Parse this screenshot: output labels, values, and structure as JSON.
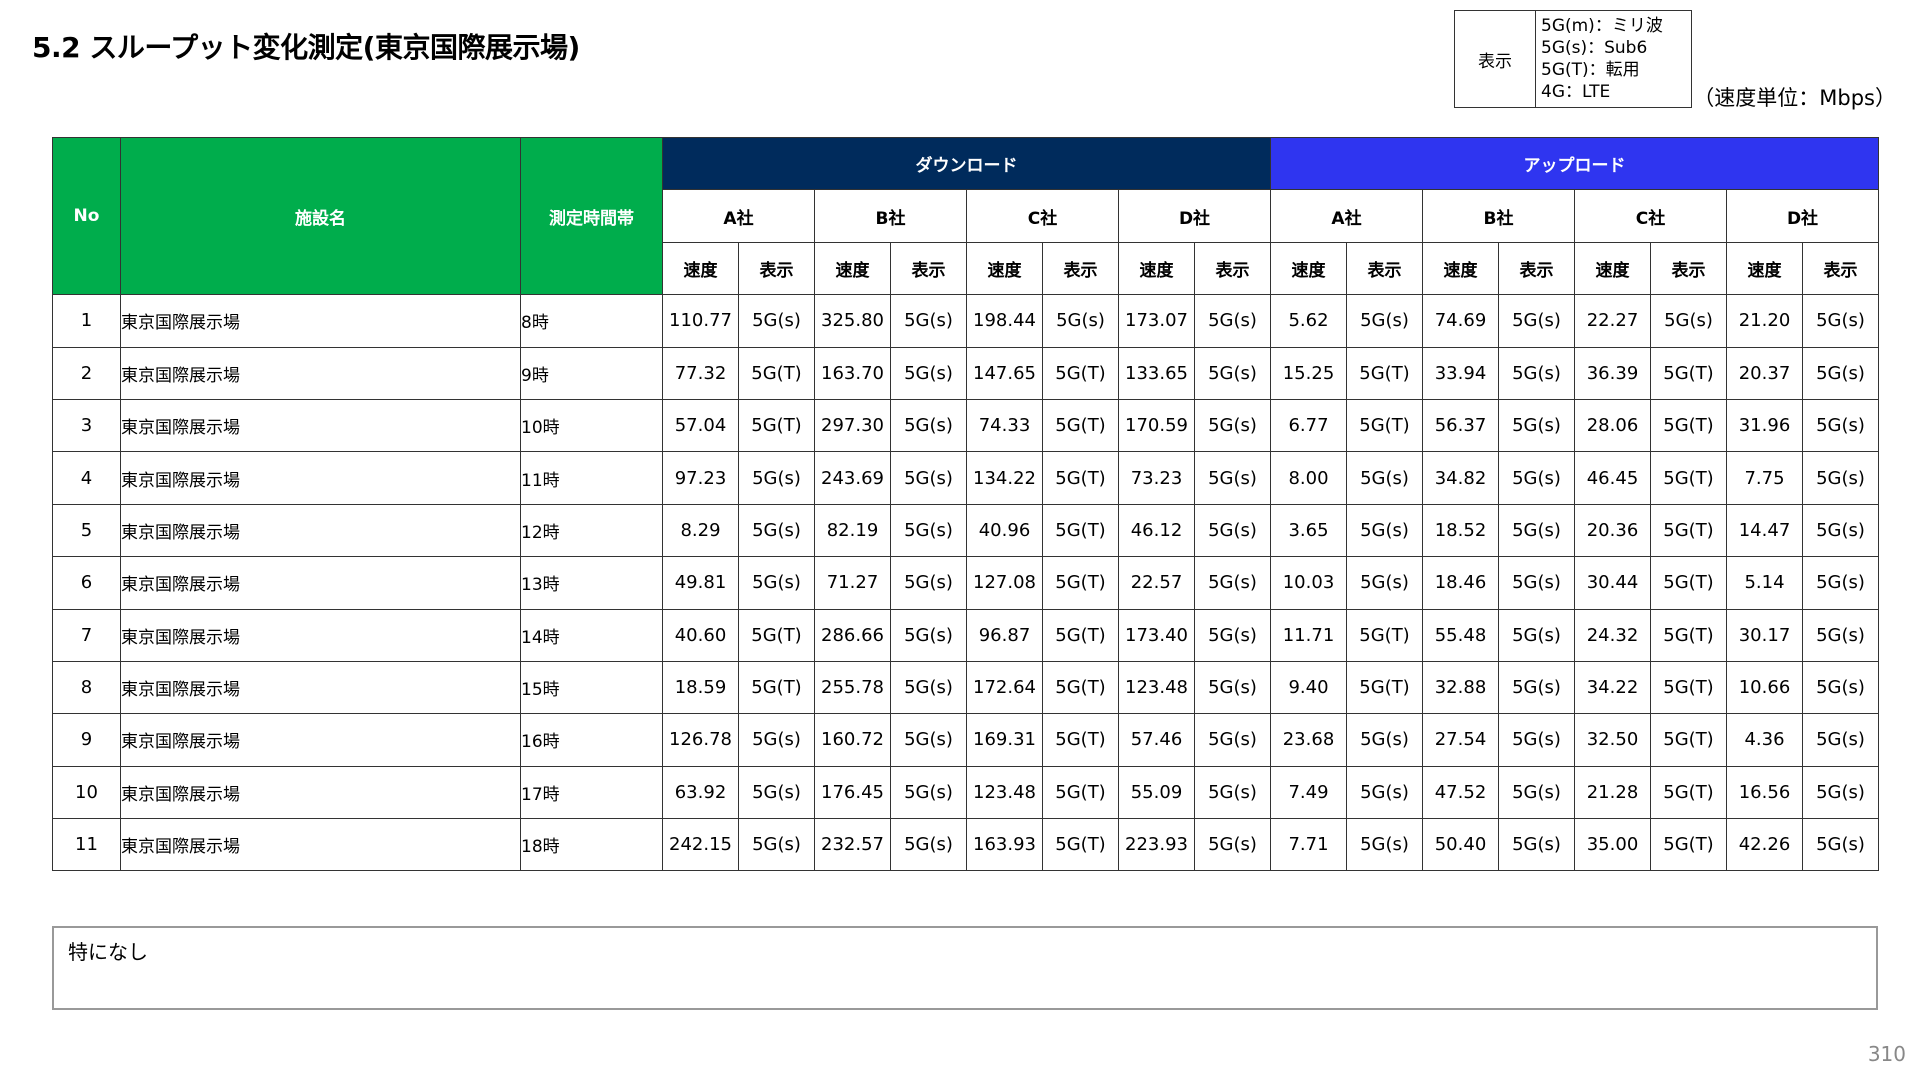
{
  "title": "5.2 スループット変化測定(東京国際展示場)",
  "legend": {
    "label": "表示",
    "items": [
      "5G(m)：ミリ波",
      "5G(s)：Sub6",
      "5G(T)：転用",
      "4G：LTE"
    ]
  },
  "unit_note": "（速度単位：Mbps）",
  "table": {
    "header": {
      "no": "No",
      "facility": "施設名",
      "time": "測定時間帯",
      "download": "ダウンロード",
      "upload": "アップロード",
      "companies": [
        "A社",
        "B社",
        "C社",
        "D社"
      ],
      "speed": "速度",
      "display": "表示"
    },
    "rows": [
      {
        "no": "1",
        "facility": "東京国際展示場",
        "time": "8時",
        "values": [
          "110.77",
          "5G(s)",
          "325.80",
          "5G(s)",
          "198.44",
          "5G(s)",
          "173.07",
          "5G(s)",
          "5.62",
          "5G(s)",
          "74.69",
          "5G(s)",
          "22.27",
          "5G(s)",
          "21.20",
          "5G(s)"
        ]
      },
      {
        "no": "2",
        "facility": "東京国際展示場",
        "time": "9時",
        "values": [
          "77.32",
          "5G(T)",
          "163.70",
          "5G(s)",
          "147.65",
          "5G(T)",
          "133.65",
          "5G(s)",
          "15.25",
          "5G(T)",
          "33.94",
          "5G(s)",
          "36.39",
          "5G(T)",
          "20.37",
          "5G(s)"
        ]
      },
      {
        "no": "3",
        "facility": "東京国際展示場",
        "time": "10時",
        "values": [
          "57.04",
          "5G(T)",
          "297.30",
          "5G(s)",
          "74.33",
          "5G(T)",
          "170.59",
          "5G(s)",
          "6.77",
          "5G(T)",
          "56.37",
          "5G(s)",
          "28.06",
          "5G(T)",
          "31.96",
          "5G(s)"
        ]
      },
      {
        "no": "4",
        "facility": "東京国際展示場",
        "time": "11時",
        "values": [
          "97.23",
          "5G(s)",
          "243.69",
          "5G(s)",
          "134.22",
          "5G(T)",
          "73.23",
          "5G(s)",
          "8.00",
          "5G(s)",
          "34.82",
          "5G(s)",
          "46.45",
          "5G(T)",
          "7.75",
          "5G(s)"
        ]
      },
      {
        "no": "5",
        "facility": "東京国際展示場",
        "time": "12時",
        "values": [
          "8.29",
          "5G(s)",
          "82.19",
          "5G(s)",
          "40.96",
          "5G(T)",
          "46.12",
          "5G(s)",
          "3.65",
          "5G(s)",
          "18.52",
          "5G(s)",
          "20.36",
          "5G(T)",
          "14.47",
          "5G(s)"
        ]
      },
      {
        "no": "6",
        "facility": "東京国際展示場",
        "time": "13時",
        "values": [
          "49.81",
          "5G(s)",
          "71.27",
          "5G(s)",
          "127.08",
          "5G(T)",
          "22.57",
          "5G(s)",
          "10.03",
          "5G(s)",
          "18.46",
          "5G(s)",
          "30.44",
          "5G(T)",
          "5.14",
          "5G(s)"
        ]
      },
      {
        "no": "7",
        "facility": "東京国際展示場",
        "time": "14時",
        "values": [
          "40.60",
          "5G(T)",
          "286.66",
          "5G(s)",
          "96.87",
          "5G(T)",
          "173.40",
          "5G(s)",
          "11.71",
          "5G(T)",
          "55.48",
          "5G(s)",
          "24.32",
          "5G(T)",
          "30.17",
          "5G(s)"
        ]
      },
      {
        "no": "8",
        "facility": "東京国際展示場",
        "time": "15時",
        "values": [
          "18.59",
          "5G(T)",
          "255.78",
          "5G(s)",
          "172.64",
          "5G(T)",
          "123.48",
          "5G(s)",
          "9.40",
          "5G(T)",
          "32.88",
          "5G(s)",
          "34.22",
          "5G(T)",
          "10.66",
          "5G(s)"
        ]
      },
      {
        "no": "9",
        "facility": "東京国際展示場",
        "time": "16時",
        "values": [
          "126.78",
          "5G(s)",
          "160.72",
          "5G(s)",
          "169.31",
          "5G(T)",
          "57.46",
          "5G(s)",
          "23.68",
          "5G(s)",
          "27.54",
          "5G(s)",
          "32.50",
          "5G(T)",
          "4.36",
          "5G(s)"
        ]
      },
      {
        "no": "10",
        "facility": "東京国際展示場",
        "time": "17時",
        "values": [
          "63.92",
          "5G(s)",
          "176.45",
          "5G(s)",
          "123.48",
          "5G(T)",
          "55.09",
          "5G(s)",
          "7.49",
          "5G(s)",
          "47.52",
          "5G(s)",
          "21.28",
          "5G(T)",
          "16.56",
          "5G(s)"
        ]
      },
      {
        "no": "11",
        "facility": "東京国際展示場",
        "time": "18時",
        "values": [
          "242.15",
          "5G(s)",
          "232.57",
          "5G(s)",
          "163.93",
          "5G(T)",
          "223.93",
          "5G(s)",
          "7.71",
          "5G(s)",
          "50.40",
          "5G(s)",
          "35.00",
          "5G(T)",
          "42.26",
          "5G(s)"
        ]
      }
    ]
  },
  "notes": "特になし",
  "page_number": "310",
  "colors": {
    "header_green": "#00ad4c",
    "download_navy": "#002b5c",
    "upload_blue": "#2f35f0"
  }
}
